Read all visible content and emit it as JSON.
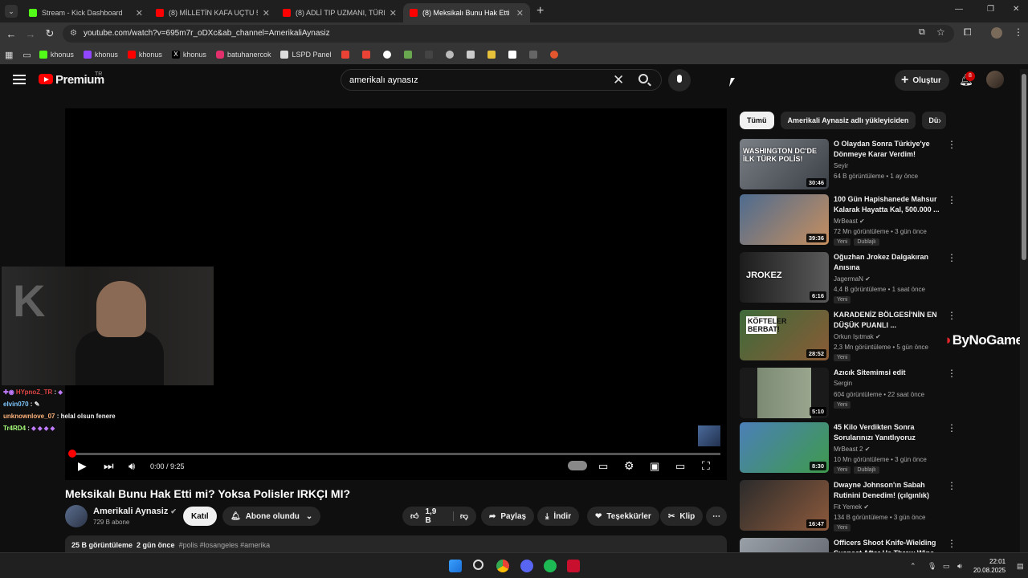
{
  "tabs": [
    {
      "title": "Stream - Kick Dashboard",
      "favicon_color": "#53fc18"
    },
    {
      "title": "(8) MİLLETİN KAFA UÇTU 5Srida",
      "favicon_color": "#ff0000"
    },
    {
      "title": "(8) ADLİ TIP UZMANI, TÜRK DİZ",
      "favicon_color": "#ff0000"
    },
    {
      "title": "(8) Meksikalı Bunu Hak Etti mi?",
      "favicon_color": "#ff0000"
    }
  ],
  "address_bar": {
    "url": "youtube.com/watch?v=695m7r_oDXc&ab_channel=AmerikaliAynasiz"
  },
  "bookmarks": [
    {
      "label": "khonus",
      "color": "#53fc18"
    },
    {
      "label": "khonus",
      "color": "#9146ff"
    },
    {
      "label": "khonus",
      "color": "#ff0000"
    },
    {
      "label": "khonus",
      "color": "#ffffff"
    },
    {
      "label": "batuhanercok",
      "color": "#e1306c"
    },
    {
      "label": "LSPD Panel",
      "color": "#dddddd"
    }
  ],
  "header": {
    "brand": "Premium",
    "region": "TR",
    "search_query": "amerikalı aynasız",
    "create_label": "Oluştur",
    "notification_count": "8"
  },
  "player": {
    "timecode": "0:00 / 9:25",
    "progress_fraction": 0.0
  },
  "chat": [
    {
      "user": "HYpnoZ_TR",
      "text": ""
    },
    {
      "user": "elvin070",
      "text": ""
    },
    {
      "user": "unknownlove_07",
      "text": "helal olsun fenere"
    },
    {
      "user": "Tr4RD4",
      "text": ""
    }
  ],
  "video": {
    "title": "Meksikalı Bunu Hak Etti mi? Yoksa Polisler IRKÇI MI?",
    "channel": "Amerikali Aynasiz",
    "subscribers": "729 B abone",
    "join_label": "Katıl",
    "subscribed_label": "Abone olundu",
    "likes": "1,9 B",
    "share_label": "Paylaş",
    "download_label": "İndir",
    "thanks_label": "Teşekkürler",
    "clip_label": "Klip",
    "views": "25 B görüntüleme",
    "age": "2 gün önce",
    "tags": "#polis #losangeles #amerika"
  },
  "chips": [
    "Tümü",
    "Amerikali Aynasiz adlı yükleyiciden",
    "Dü"
  ],
  "recommendations": [
    {
      "title": "O Olaydan Sonra Türkiye'ye Dönmeye Karar Verdim!",
      "channel": "Seyir",
      "meta": "64 B görüntüleme • 1 ay önce",
      "duration": "30:46",
      "thumb_text": "WASHINGTON DC'DE İLK TÜRK POLİS!",
      "tags": [],
      "verified": false
    },
    {
      "title": "100 Gün Hapishanede Mahsur Kalarak Hayatta Kal, 500.000 ...",
      "channel": "MrBeast",
      "meta": "72 Mn görüntüleme • 3 gün önce",
      "duration": "39:36",
      "thumb_text": "",
      "tags": [
        "Yeni",
        "Dublajlı"
      ],
      "verified": true
    },
    {
      "title": "Oğuzhan Jrokez Dalgakıran Anısına",
      "channel": "JagermaN",
      "meta": "4,4 B görüntüleme • 1 saat önce",
      "duration": "6:16",
      "thumb_text": "JROKEZ",
      "tags": [
        "Yeni"
      ],
      "verified": true
    },
    {
      "title": "KARADENİZ BÖLGESİ'NİN EN DÜŞÜK PUANLI ...",
      "channel": "Orkun Işıtmak",
      "meta": "2,3 Mn görüntüleme • 5 gün önce",
      "duration": "28:52",
      "thumb_text": "KÖFTELER BERBAT!",
      "tags": [
        "Yeni"
      ],
      "verified": true
    },
    {
      "title": "Azıcık Sitemimsi edit",
      "channel": "Sergin",
      "meta": "604 görüntüleme • 22 saat önce",
      "duration": "5:10",
      "thumb_text": "",
      "tags": [
        "Yeni"
      ],
      "verified": false
    },
    {
      "title": "45 Kilo Verdikten Sonra Sorularınızı Yanıtlıyoruz",
      "channel": "MrBeast 2",
      "meta": "10 Mn görüntüleme • 3 gün önce",
      "duration": "8:30",
      "thumb_text": "",
      "tags": [
        "Yeni",
        "Dublajlı"
      ],
      "verified": true
    },
    {
      "title": "Dwayne Johnson'ın Sabah Rutinini Denedim! (çılgınlık)",
      "channel": "Fit Yemek",
      "meta": "134 B görüntüleme • 3 gün önce",
      "duration": "16:47",
      "thumb_text": "",
      "tags": [
        "Yeni"
      ],
      "verified": true
    },
    {
      "title": "Officers Shoot Knife-Wielding Suspect After He Threw Wine",
      "channel": "",
      "meta": "",
      "duration": "",
      "thumb_text": "",
      "tags": [],
      "verified": false
    }
  ],
  "overlay_logo": "ByNoGame",
  "clock": {
    "time": "22:01",
    "date": "20.08.2025"
  }
}
